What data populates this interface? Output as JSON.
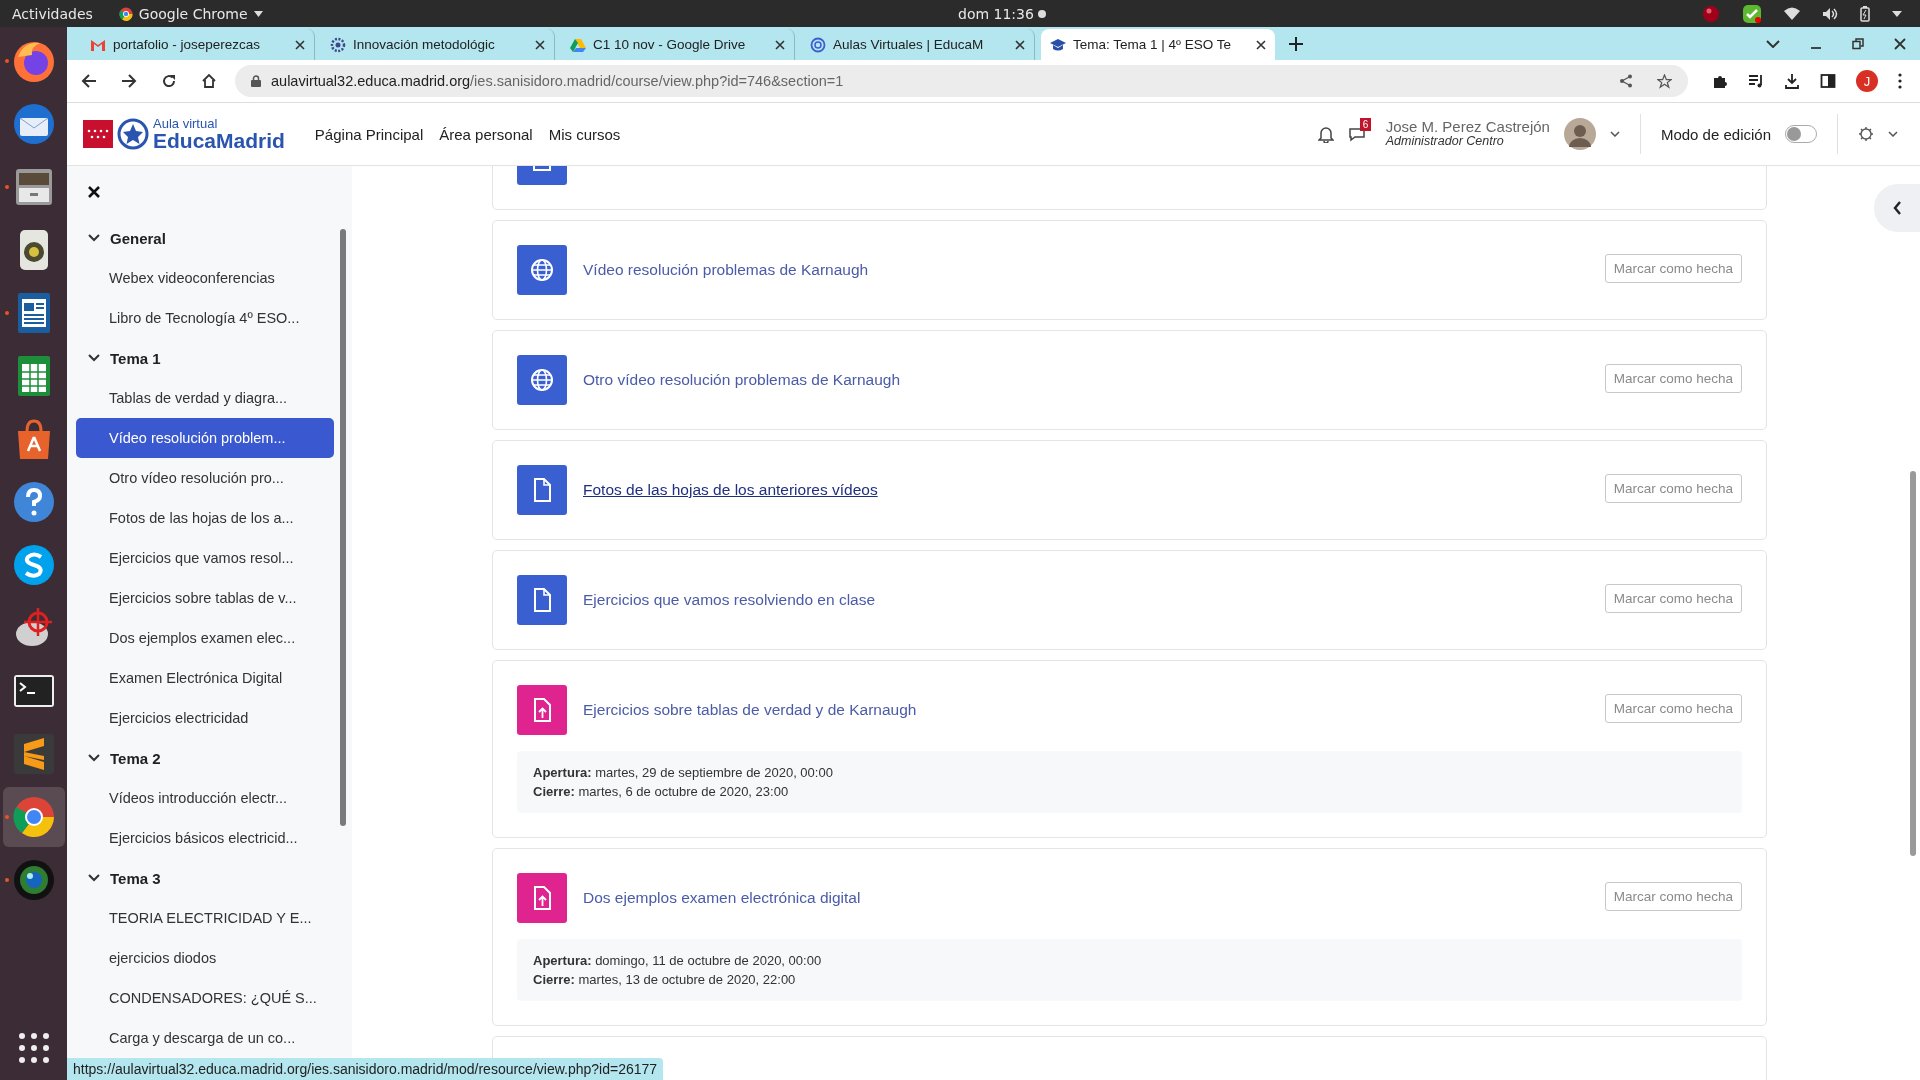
{
  "system_bar": {
    "activities": "Actividades",
    "app": "Google Chrome",
    "clock": "dom 11:36"
  },
  "dock": [
    {
      "kind": "firefox",
      "running": true,
      "selected": false
    },
    {
      "kind": "mail",
      "running": false,
      "selected": false
    },
    {
      "kind": "files",
      "running": true,
      "selected": false
    },
    {
      "kind": "speaker",
      "running": false,
      "selected": false
    },
    {
      "kind": "writer",
      "running": true,
      "selected": false
    },
    {
      "kind": "calc",
      "running": false,
      "selected": false
    },
    {
      "kind": "store",
      "running": false,
      "selected": false
    },
    {
      "kind": "help",
      "running": false,
      "selected": false
    },
    {
      "kind": "skype",
      "running": false,
      "selected": false
    },
    {
      "kind": "target",
      "running": false,
      "selected": false
    },
    {
      "kind": "terminal",
      "running": false,
      "selected": false
    },
    {
      "kind": "sublime",
      "running": false,
      "selected": false
    },
    {
      "kind": "chrome",
      "running": true,
      "selected": true
    },
    {
      "kind": "camera",
      "running": true,
      "selected": false
    }
  ],
  "browser": {
    "tabs": [
      {
        "title": "portafolio - joseperezcas",
        "selected": false
      },
      {
        "title": "Innovación metodológic",
        "selected": false
      },
      {
        "title": "C1 10 nov - Google Drive",
        "selected": false
      },
      {
        "title": "Aulas Virtuales | EducaM",
        "selected": false
      },
      {
        "title": "Tema: Tema 1 | 4º ESO Te",
        "selected": true
      }
    ],
    "url_host": "aulavirtual32.educa.madrid.org",
    "url_path": "/ies.sanisidoro.madrid/course/view.php?id=746&section=1",
    "profile_initial": "J"
  },
  "header": {
    "logo_small": "Aula virtual",
    "logo_big": "EducaMadrid",
    "nav": [
      "Página Principal",
      "Área personal",
      "Mis cursos"
    ],
    "message_count": "6",
    "user_name": "Jose M. Perez Castrejón",
    "user_role": "Administrador Centro",
    "edit_mode_label": "Modo de edición",
    "edit_mode_on": false
  },
  "sidebar": {
    "sections": [
      {
        "title": "General",
        "expanded": true,
        "children": [
          {
            "label": "Webex videoconferencias",
            "selected": false
          },
          {
            "label": "Libro de Tecnología 4º ESO...",
            "selected": false
          }
        ]
      },
      {
        "title": "Tema 1",
        "expanded": true,
        "children": [
          {
            "label": "Tablas de verdad y diagra...",
            "selected": false
          },
          {
            "label": "Vídeo resolución problem...",
            "selected": true
          },
          {
            "label": "Otro vídeo resolución pro...",
            "selected": false
          },
          {
            "label": "Fotos de las hojas de los a...",
            "selected": false
          },
          {
            "label": "Ejercicios que vamos resol...",
            "selected": false
          },
          {
            "label": "Ejercicios sobre tablas de v...",
            "selected": false
          },
          {
            "label": "Dos ejemplos examen elec...",
            "selected": false
          },
          {
            "label": "Examen Electrónica Digital",
            "selected": false
          },
          {
            "label": "Ejercicios electricidad",
            "selected": false
          }
        ]
      },
      {
        "title": "Tema 2",
        "expanded": true,
        "children": [
          {
            "label": "Vídeos introducción electr...",
            "selected": false
          },
          {
            "label": "Ejercicios básicos electricid...",
            "selected": false
          }
        ]
      },
      {
        "title": "Tema 3",
        "expanded": true,
        "children": [
          {
            "label": "TEORIA ELECTRICIDAD Y E...",
            "selected": false
          },
          {
            "label": "ejercicios diodos",
            "selected": false
          },
          {
            "label": "CONDENSADORES: ¿QUÉ S...",
            "selected": false
          },
          {
            "label": "Carga y descarga de un co...",
            "selected": false
          }
        ]
      }
    ]
  },
  "activities": [
    {
      "kind": "page"
    },
    {
      "kind": "url",
      "title": "Vídeo resolución problemas de Karnaugh",
      "button": "Marcar como hecha",
      "hovered": false
    },
    {
      "kind": "url",
      "title": "Otro vídeo resolución problemas de Karnaugh",
      "button": "Marcar como hecha",
      "hovered": false
    },
    {
      "kind": "resource",
      "title": "Fotos de las hojas de los anteriores vídeos",
      "button": "Marcar como hecha",
      "hovered": true
    },
    {
      "kind": "resource",
      "title": "Ejercicios que vamos resolviendo en clase",
      "button": "Marcar como hecha",
      "hovered": false
    },
    {
      "kind": "assign",
      "title": "Ejercicios sobre tablas de verdad y de Karnaugh",
      "button": "Marcar como hecha",
      "hovered": false,
      "dates": [
        "**Apertura:** martes, 29 de septiembre de 2020, 00:00",
        "**Cierre:** martes, 6 de octubre de 2020, 23:00"
      ]
    },
    {
      "kind": "assign",
      "title": "Dos ejemplos examen electrónica digital",
      "button": "Marcar como hecha",
      "hovered": false,
      "dates": [
        "**Apertura:** domingo, 11 de octubre de 2020, 00:00",
        "**Cierre:** martes, 13 de octubre de 2020, 22:00"
      ]
    }
  ],
  "status_url": "https://aulavirtual32.educa.madrid.org/ies.sanisidoro.madrid/mod/resource/view.php?id=26177"
}
